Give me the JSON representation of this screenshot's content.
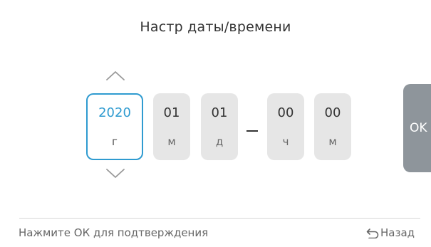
{
  "screen": {
    "title": "Настр даты/времени"
  },
  "spinners": {
    "year": {
      "value": "2020",
      "unit": "г"
    },
    "month": {
      "value": "01",
      "unit": "м"
    },
    "day": {
      "value": "01",
      "unit": "д"
    },
    "hour": {
      "value": "00",
      "unit": "ч"
    },
    "minute": {
      "value": "00",
      "unit": "м"
    }
  },
  "active_field": "year",
  "ok_button": {
    "label": "OK"
  },
  "footer": {
    "hint": "Нажмите ОК для подтверждения",
    "back_label": "Назад"
  },
  "icons": {
    "increment": "chevron-up-icon",
    "decrement": "chevron-down-icon",
    "back": "back-arrow-icon"
  },
  "colors": {
    "accent": "#2f9bd0",
    "spinner_bg": "#e6e6e6",
    "ok_bg": "#8e959b",
    "text": "#333333",
    "muted_text": "#666666"
  }
}
